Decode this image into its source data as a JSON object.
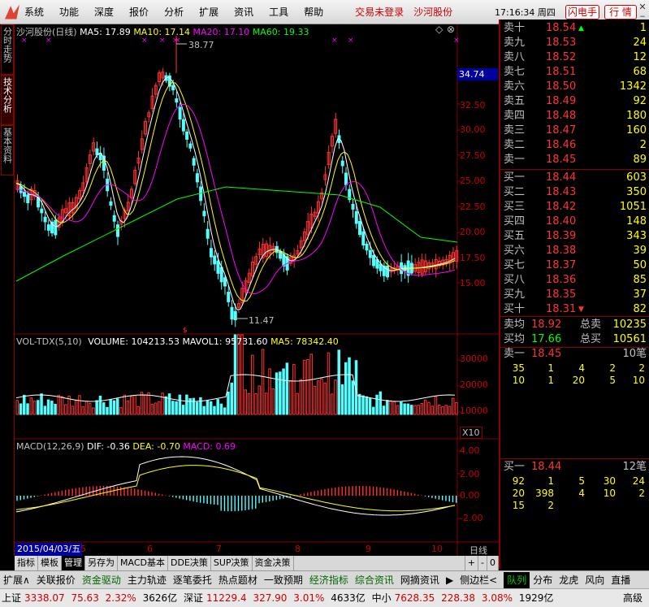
{
  "menu": {
    "items": [
      "系统",
      "功能",
      "深度",
      "报价",
      "分析",
      "扩展",
      "资讯",
      "工具",
      "帮助"
    ],
    "trade_status": "交易未登录",
    "stock_name": "沙河股份",
    "time": "17:16:34 周四",
    "btn_flash": "闪电手",
    "btn_quote": "行 情"
  },
  "left_tabs": [
    "分时走势",
    "技术分析",
    "基本资料"
  ],
  "chart_header": {
    "name": "沙河股份(日线)",
    "ma5": "MA5: 17.89",
    "ma10": "MA10: 17.14",
    "ma20": "MA20: 17.10",
    "ma60": "MA60: 19.33",
    "high_label": "38.77",
    "low_label": "11.47",
    "current_price_box": "34.74"
  },
  "price_axis": [
    "32.50",
    "30.00",
    "27.50",
    "25.00",
    "22.50",
    "20.00",
    "17.50",
    "15.00"
  ],
  "vol_header": {
    "name": "VOL-TDX(5,10)",
    "volume": "VOLUME: 104213.53",
    "mavol1": "MAVOL1: 95731.60",
    "ma5": "MA5: 78342.40"
  },
  "vol_axis": [
    "30000",
    "20000",
    "10000"
  ],
  "vol_unit": "X10",
  "macd_header": {
    "name": "MACD(12,26,9)",
    "dif": "DIF: -0.36",
    "dea": "DEA: -0.70",
    "macd": "MACD: 0.69"
  },
  "macd_axis": [
    "4.00",
    "2.00",
    "0.00",
    "-2.00"
  ],
  "date_axis": {
    "start": "2015/04/03/五",
    "months": [
      "5",
      "6",
      "7",
      "8",
      "9",
      "10"
    ],
    "period": "日线"
  },
  "sell_orders": [
    {
      "label": "卖十",
      "price": "18.54",
      "vol": "1"
    },
    {
      "label": "卖九",
      "price": "18.53",
      "vol": "24"
    },
    {
      "label": "卖八",
      "price": "18.52",
      "vol": "12"
    },
    {
      "label": "卖七",
      "price": "18.51",
      "vol": "68"
    },
    {
      "label": "卖六",
      "price": "18.50",
      "vol": "1342"
    },
    {
      "label": "卖五",
      "price": "18.49",
      "vol": "92"
    },
    {
      "label": "卖四",
      "price": "18.48",
      "vol": "180"
    },
    {
      "label": "卖三",
      "price": "18.47",
      "vol": "160"
    },
    {
      "label": "卖二",
      "price": "18.46",
      "vol": "2"
    },
    {
      "label": "卖一",
      "price": "18.45",
      "vol": "89"
    }
  ],
  "buy_orders": [
    {
      "label": "买一",
      "price": "18.44",
      "vol": "603"
    },
    {
      "label": "买二",
      "price": "18.43",
      "vol": "350"
    },
    {
      "label": "买三",
      "price": "18.42",
      "vol": "1051"
    },
    {
      "label": "买四",
      "price": "18.40",
      "vol": "148"
    },
    {
      "label": "买五",
      "price": "18.39",
      "vol": "343"
    },
    {
      "label": "买六",
      "price": "18.38",
      "vol": "39"
    },
    {
      "label": "买七",
      "price": "18.37",
      "vol": "50"
    },
    {
      "label": "买八",
      "price": "18.36",
      "vol": "85"
    },
    {
      "label": "买九",
      "price": "18.35",
      "vol": "37"
    },
    {
      "label": "买十",
      "price": "18.31",
      "vol": "82"
    }
  ],
  "summary": {
    "sell_avg_label": "卖均",
    "sell_avg": "18.92",
    "total_sell_label": "总卖",
    "total_sell": "10235",
    "buy_avg_label": "买均",
    "buy_avg": "17.66",
    "total_buy_label": "总买",
    "total_buy": "10561"
  },
  "sell1_detail": {
    "label": "卖一",
    "price": "18.45",
    "count": "10笔",
    "rows": [
      [
        "35",
        "1",
        "4",
        "2",
        "2"
      ],
      [
        "10",
        "1",
        "20",
        "5",
        "10"
      ]
    ]
  },
  "buy1_detail": {
    "label": "买一",
    "price": "18.44",
    "count": "12笔",
    "rows": [
      [
        "92",
        "1",
        "5",
        "30",
        "24"
      ],
      [
        "20",
        "398",
        "4",
        "10",
        "2"
      ],
      [
        "15",
        "2",
        "",
        "",
        ""
      ]
    ]
  },
  "tabbar": [
    "指标",
    "模板",
    "管理",
    "另存为",
    "MACD基本",
    "DDE决策",
    "SUP决策",
    "资金决策"
  ],
  "tabbar_right": [
    "+",
    "-",
    "0"
  ],
  "bottom_tabs": [
    "扩展∧",
    "关联报价",
    "资金驱动",
    "主力轨迹",
    "逐笔委托",
    "热点题材",
    "一致预期",
    "经济指标",
    "综合资讯",
    "网摘资讯",
    "▶",
    "侧边栏<"
  ],
  "right_tabs": [
    "队列",
    "分布",
    "龙虎",
    "风向",
    "直播"
  ],
  "status": {
    "sh_label": "上证",
    "sh_val": "3338.07",
    "sh_chg": "75.63",
    "sh_pct": "2.32%",
    "sh_amt": "3626亿",
    "sz_label": "深证",
    "sz_val": "11229.4",
    "sz_chg": "327.90",
    "sz_pct": "3.01%",
    "sz_amt": "4633亿",
    "zx_label": "中小",
    "zx_val": "7628.35",
    "zx_chg": "228.38",
    "zx_pct": "3.08%",
    "zx_amt": "1929亿",
    "right": "高级"
  },
  "colors": {
    "up": "#ff3232",
    "down": "#54ffff",
    "ma5": "#ffffff",
    "ma10": "#ffff00",
    "ma20": "#ff00ff",
    "ma60": "#00ff00",
    "grid": "#800000"
  }
}
